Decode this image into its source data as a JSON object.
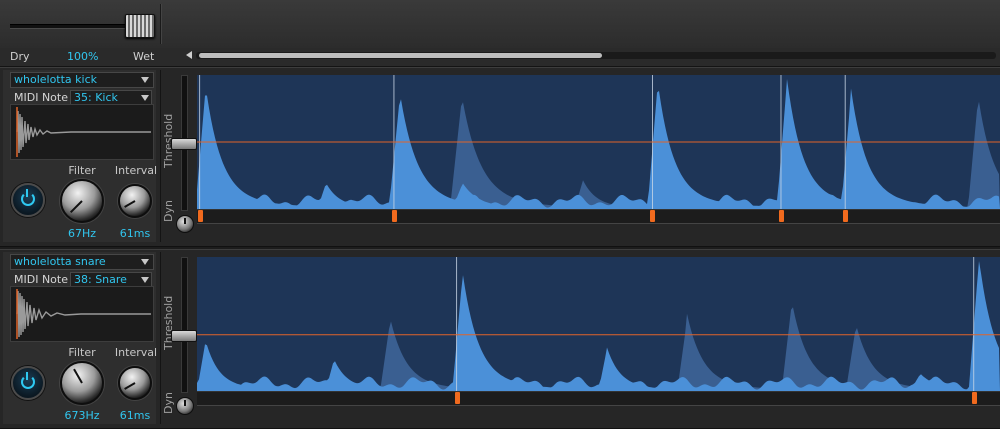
{
  "mix": {
    "dry_label": "Dry",
    "value": "100%",
    "wet_label": "Wet",
    "level": 1.0
  },
  "scrollbar": {
    "start_fraction": 0.0,
    "visible_fraction": 0.5
  },
  "colors": {
    "accent": "#31c6ef",
    "waveform": "#4b90d8",
    "waveform_ghost": "#3a5f91",
    "wave_bg": "#1e3557",
    "threshold_line": "#e0642a",
    "trigger_marker": "#f06a1e"
  },
  "lanes": [
    {
      "sample_name": "wholelotta kick",
      "midi_label": "MIDI Note",
      "midi_note": "35: Kick",
      "filter_label": "Filter",
      "filter_value": "67Hz",
      "interval_label": "Interval",
      "interval_value": "61ms",
      "threshold_label": "Threshold",
      "dyn_label": "Dyn",
      "threshold_level": 0.5,
      "power_icon": "power-icon",
      "triggers": [
        0.002,
        0.244,
        0.566,
        0.726,
        0.806
      ],
      "peaks": [
        {
          "pos": 0.01,
          "height": 0.85,
          "width": 0.012,
          "kind": "main"
        },
        {
          "pos": 0.252,
          "height": 0.8,
          "width": 0.013,
          "kind": "main"
        },
        {
          "pos": 0.329,
          "height": 0.78,
          "width": 0.014,
          "kind": "ghost"
        },
        {
          "pos": 0.33,
          "height": 0.18,
          "width": 0.012,
          "kind": "main"
        },
        {
          "pos": 0.573,
          "height": 0.88,
          "width": 0.012,
          "kind": "main"
        },
        {
          "pos": 0.734,
          "height": 0.9,
          "width": 0.012,
          "kind": "main"
        },
        {
          "pos": 0.814,
          "height": 0.82,
          "width": 0.012,
          "kind": "main"
        },
        {
          "pos": 0.972,
          "height": 0.78,
          "width": 0.012,
          "kind": "ghost"
        },
        {
          "pos": 0.16,
          "height": 0.18,
          "width": 0.01,
          "kind": "main"
        },
        {
          "pos": 0.48,
          "height": 0.2,
          "width": 0.01,
          "kind": "ghost"
        }
      ]
    },
    {
      "sample_name": "wholelotta snare",
      "midi_label": "MIDI Note",
      "midi_note": "38: Snare",
      "filter_label": "Filter",
      "filter_value": "673Hz",
      "interval_label": "Interval",
      "interval_value": "61ms",
      "threshold_label": "Threshold",
      "dyn_label": "Dyn",
      "threshold_level": 0.42,
      "power_icon": "power-icon",
      "triggers": [
        0.322,
        0.966
      ],
      "peaks": [
        {
          "pos": 0.33,
          "height": 0.82,
          "width": 0.012,
          "kind": "main"
        },
        {
          "pos": 0.973,
          "height": 0.92,
          "width": 0.012,
          "kind": "main"
        },
        {
          "pos": 0.01,
          "height": 0.35,
          "width": 0.01,
          "kind": "main"
        },
        {
          "pos": 0.17,
          "height": 0.22,
          "width": 0.01,
          "kind": "main"
        },
        {
          "pos": 0.24,
          "height": 0.5,
          "width": 0.012,
          "kind": "ghost"
        },
        {
          "pos": 0.51,
          "height": 0.3,
          "width": 0.01,
          "kind": "main"
        },
        {
          "pos": 0.61,
          "height": 0.52,
          "width": 0.012,
          "kind": "ghost"
        },
        {
          "pos": 0.74,
          "height": 0.62,
          "width": 0.012,
          "kind": "ghost"
        },
        {
          "pos": 0.82,
          "height": 0.46,
          "width": 0.012,
          "kind": "ghost"
        },
        {
          "pos": 0.9,
          "height": 0.12,
          "width": 0.012,
          "kind": "main"
        }
      ]
    }
  ]
}
